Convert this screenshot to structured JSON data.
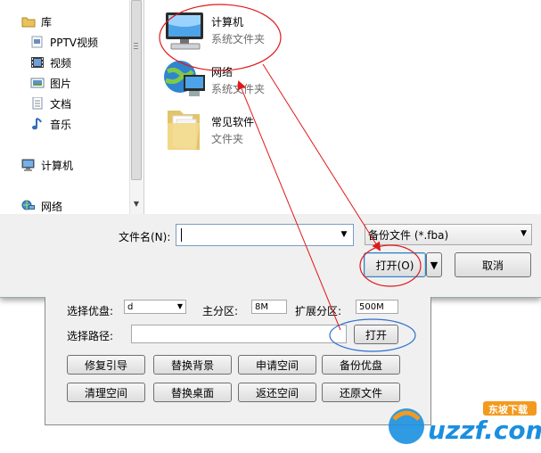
{
  "dialog": {
    "nav": {
      "items": [
        {
          "label": "库",
          "icon": "library-icon"
        },
        {
          "label": "PPTV视频",
          "icon": "video-library-icon"
        },
        {
          "label": "视频",
          "icon": "video-icon"
        },
        {
          "label": "图片",
          "icon": "picture-icon"
        },
        {
          "label": "文档",
          "icon": "document-icon"
        },
        {
          "label": "音乐",
          "icon": "music-icon"
        },
        {
          "label": "计算机",
          "icon": "computer-icon"
        },
        {
          "label": "网络",
          "icon": "network-icon"
        }
      ]
    },
    "files": [
      {
        "name": "计算机",
        "type": "系统文件夹",
        "icon": "computer-icon"
      },
      {
        "name": "网络",
        "type": "系统文件夹",
        "icon": "network-icon"
      },
      {
        "name": "常见软件",
        "type": "文件夹",
        "icon": "folder-icon"
      }
    ],
    "filename_label": "文件名(N):",
    "filename_value": "",
    "filetype_value": "备份文件 (*.fba)",
    "open_label": "打开(O)",
    "cancel_label": "取消"
  },
  "app": {
    "disk_label": "选择优盘:",
    "disk_value": "d",
    "primary_label": "主分区:",
    "primary_value": "8M",
    "extended_label": "扩展分区:",
    "extended_value": "500M",
    "path_label": "选择路径:",
    "path_value": "",
    "open_label": "打开",
    "buttons": [
      [
        "修复引导",
        "替换背景",
        "申请空间",
        "备份优盘"
      ],
      [
        "清理空间",
        "替换桌面",
        "返还空间",
        "还原文件"
      ]
    ]
  },
  "watermark": {
    "brand": "uzzf.com",
    "tag": "东坡下载"
  },
  "colors": {
    "annotation_red": "#e0191b",
    "annotation_blue": "#2d6fd0",
    "watermark_blue": "#1a8fe0",
    "watermark_orange": "#f39a1e"
  }
}
